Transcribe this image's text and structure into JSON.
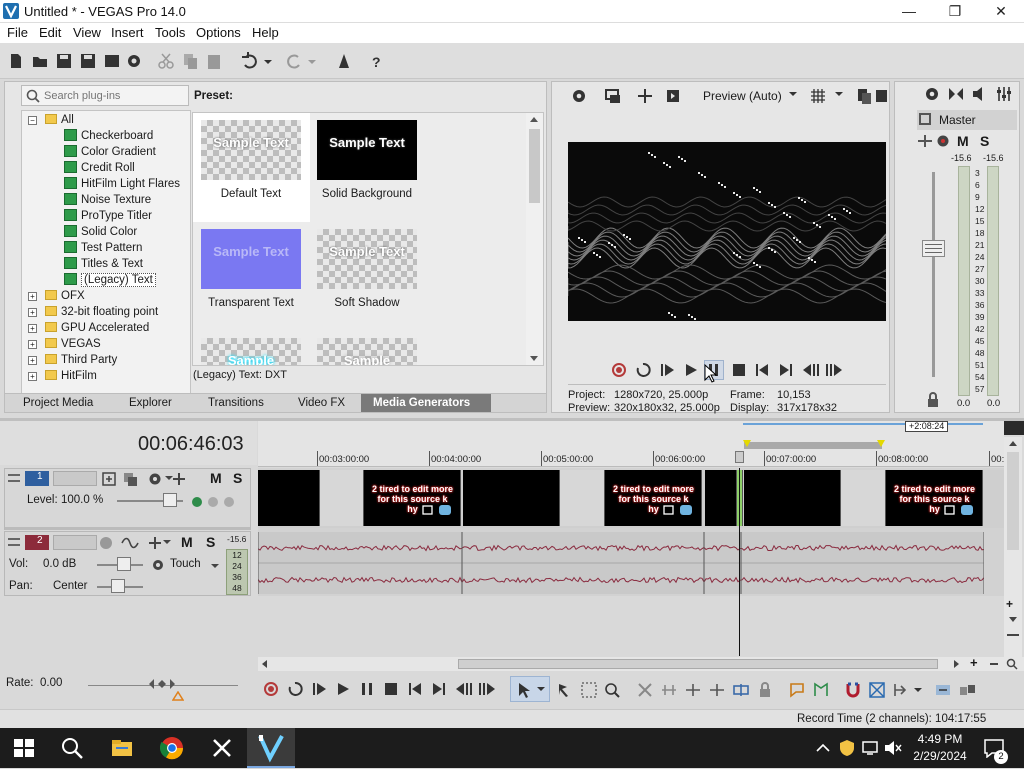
{
  "window": {
    "title": "Untitled * - VEGAS Pro 14.0",
    "controls": [
      "minimize-icon",
      "restore-icon",
      "close-icon"
    ]
  },
  "menu": [
    "File",
    "Edit",
    "View",
    "Insert",
    "Tools",
    "Options",
    "Help"
  ],
  "plugins": {
    "search_placeholder": "Search plug-ins",
    "tree": [
      {
        "label": "All",
        "level": 0,
        "type": "folder",
        "expanded": true
      },
      {
        "label": "Checkerboard",
        "level": 1,
        "type": "plugin"
      },
      {
        "label": "Color Gradient",
        "level": 1,
        "type": "plugin"
      },
      {
        "label": "Credit Roll",
        "level": 1,
        "type": "plugin"
      },
      {
        "label": "HitFilm Light Flares",
        "level": 1,
        "type": "plugin"
      },
      {
        "label": "Noise Texture",
        "level": 1,
        "type": "plugin"
      },
      {
        "label": "ProType Titler",
        "level": 1,
        "type": "plugin"
      },
      {
        "label": "Solid Color",
        "level": 1,
        "type": "plugin"
      },
      {
        "label": "Test Pattern",
        "level": 1,
        "type": "plugin"
      },
      {
        "label": "Titles & Text",
        "level": 1,
        "type": "plugin"
      },
      {
        "label": "(Legacy) Text",
        "level": 1,
        "type": "plugin",
        "selected": true
      },
      {
        "label": "OFX",
        "level": 0,
        "type": "folder"
      },
      {
        "label": "32-bit floating point",
        "level": 0,
        "type": "folder"
      },
      {
        "label": "GPU Accelerated",
        "level": 0,
        "type": "folder"
      },
      {
        "label": "VEGAS",
        "level": 0,
        "type": "folder"
      },
      {
        "label": "Third Party",
        "level": 0,
        "type": "folder"
      },
      {
        "label": "HitFilm",
        "level": 0,
        "type": "folder"
      }
    ]
  },
  "presets": {
    "header": "Preset:",
    "items": [
      {
        "label": "Default Text",
        "thumb": "Sample Text",
        "style": "checker-white"
      },
      {
        "label": "Solid Background",
        "thumb": "Sample Text",
        "style": "black"
      },
      {
        "label": "Transparent Text",
        "thumb": "Sample Text",
        "style": "blue"
      },
      {
        "label": "Soft Shadow",
        "thumb": "Sample Text",
        "style": "checker-shadow"
      },
      {
        "label": "",
        "thumb": "Sample",
        "style": "checker-cyan"
      },
      {
        "label": "",
        "thumb": "Sample",
        "style": "checker-blur"
      }
    ],
    "status": "(Legacy) Text: DXT"
  },
  "left_tabs": [
    "Project Media",
    "Explorer",
    "Transitions",
    "Video FX",
    "Media Generators"
  ],
  "active_tab": "Media Generators",
  "preview": {
    "mode": "Preview (Auto)",
    "project_label": "Project:",
    "project_value": "1280x720, 25.000p",
    "preview_label": "Preview:",
    "preview_value": "320x180x32, 25.000p",
    "frame_label": "Frame:",
    "frame_value": "10,153",
    "display_label": "Display:",
    "display_value": "317x178x32"
  },
  "master": {
    "label": "Master",
    "m": "M",
    "s": "S",
    "peak_left": "-15.6",
    "peak_right": "-15.6",
    "scale": [
      "3",
      "6",
      "9",
      "12",
      "15",
      "18",
      "21",
      "24",
      "27",
      "30",
      "33",
      "36",
      "39",
      "42",
      "45",
      "48",
      "51",
      "54",
      "57"
    ],
    "bottom_left": "0.0",
    "bottom_right": "0.0"
  },
  "timeline": {
    "timecode": "00:06:46:03",
    "region_label": "+2:08:24",
    "ruler": [
      "00:03:00:00",
      "00:04:00:00",
      "00:05:00:00",
      "00:06:00:00",
      "00:07:00:00",
      "00:08:00:00",
      "00:"
    ],
    "clip_text": "2 tired to edit more for this source k hy",
    "tracks": [
      {
        "number": "1",
        "kind": "video",
        "level_label": "Level:",
        "level_value": "100.0 %",
        "m": "M",
        "s": "S"
      },
      {
        "number": "2",
        "kind": "audio",
        "vol_label": "Vol:",
        "vol_value": "0.0 dB",
        "pan_label": "Pan:",
        "pan_value": "Center",
        "touch": "Touch",
        "m": "M",
        "s": "S",
        "peak": "-15.6",
        "scale": [
          "12",
          "24",
          "36",
          "48"
        ]
      }
    ]
  },
  "transport": {
    "rate_label": "Rate:",
    "rate_value": "0.00"
  },
  "status_bar": {
    "record_time": "Record Time (2 channels): 104:17:55"
  },
  "taskbar": {
    "time": "4:49 PM",
    "date": "2/29/2024",
    "notification_count": "2"
  }
}
